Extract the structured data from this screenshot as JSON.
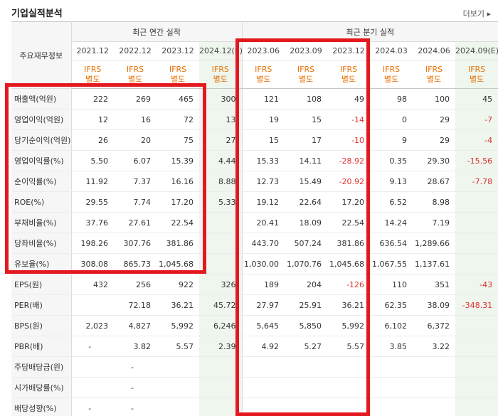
{
  "header": {
    "title": "기업실적분석",
    "more_label": "더보기 ▸"
  },
  "table": {
    "stub_label": "주요재무정보",
    "annual_group_label": "최근 연간 실적",
    "quarter_group_label": "최근 분기 실적",
    "periods": [
      "2021.12",
      "2022.12",
      "2023.12",
      "2024.12(E)",
      "2023.06",
      "2023.09",
      "2023.12",
      "2024.03",
      "2024.06",
      "2024.09(E)"
    ],
    "standard_label_line1": "IFRS",
    "standard_label_line2": "별도",
    "rows": [
      {
        "label": "매출액(억원)",
        "values": [
          "222",
          "269",
          "465",
          "300",
          "121",
          "108",
          "49",
          "98",
          "100",
          "45"
        ]
      },
      {
        "label": "영업이익(억원)",
        "values": [
          "12",
          "16",
          "72",
          "13",
          "19",
          "15",
          "-14",
          "0",
          "29",
          "-7"
        ]
      },
      {
        "label": "당기순이익(억원)",
        "values": [
          "26",
          "20",
          "75",
          "27",
          "15",
          "17",
          "-10",
          "9",
          "29",
          "-4"
        ]
      },
      {
        "label": "영업이익률(%)",
        "values": [
          "5.50",
          "6.07",
          "15.39",
          "4.44",
          "15.33",
          "14.11",
          "-28.92",
          "0.35",
          "29.30",
          "-15.56"
        ]
      },
      {
        "label": "순이익률(%)",
        "values": [
          "11.92",
          "7.37",
          "16.16",
          "8.88",
          "12.73",
          "15.49",
          "-20.92",
          "9.13",
          "28.67",
          "-7.78"
        ]
      },
      {
        "label": "ROE(%)",
        "values": [
          "29.55",
          "7.74",
          "17.20",
          "5.33",
          "19.12",
          "22.64",
          "17.20",
          "6.52",
          "8.98",
          ""
        ]
      },
      {
        "label": "부채비율(%)",
        "values": [
          "37.76",
          "27.61",
          "22.54",
          "",
          "20.41",
          "18.09",
          "22.54",
          "14.24",
          "7.19",
          ""
        ]
      },
      {
        "label": "당좌비율(%)",
        "values": [
          "198.26",
          "307.76",
          "381.86",
          "",
          "443.70",
          "507.24",
          "381.86",
          "636.54",
          "1,289.66",
          ""
        ]
      },
      {
        "label": "유보율(%)",
        "values": [
          "308.08",
          "865.73",
          "1,045.68",
          "",
          "1,030.00",
          "1,070.76",
          "1,045.68",
          "1,067.55",
          "1,137.61",
          ""
        ]
      },
      {
        "label": "EPS(원)",
        "values": [
          "432",
          "256",
          "922",
          "326",
          "189",
          "204",
          "-126",
          "110",
          "351",
          "-43"
        ]
      },
      {
        "label": "PER(배)",
        "values": [
          "",
          "72.18",
          "36.21",
          "45.72",
          "27.97",
          "25.91",
          "36.21",
          "62.35",
          "38.09",
          "-348.31"
        ]
      },
      {
        "label": "BPS(원)",
        "values": [
          "2,023",
          "4,827",
          "5,992",
          "6,246",
          "5,645",
          "5,850",
          "5,992",
          "6,102",
          "6,372",
          ""
        ]
      },
      {
        "label": "PBR(배)",
        "values": [
          "-",
          "3.82",
          "5.57",
          "2.39",
          "4.92",
          "5.27",
          "5.57",
          "3.85",
          "3.22",
          ""
        ]
      },
      {
        "label": "주당배당금(원)",
        "values": [
          "",
          "-",
          "",
          "",
          "",
          "",
          "",
          "",
          "",
          ""
        ]
      },
      {
        "label": "시가배당률(%)",
        "values": [
          "",
          "-",
          "",
          "",
          "",
          "",
          "",
          "",
          "",
          ""
        ]
      },
      {
        "label": "배당성향(%)",
        "values": [
          "-",
          "-",
          "",
          "",
          "",
          "",
          "",
          "",
          "",
          ""
        ]
      }
    ]
  },
  "highlight_color": "#e3191f",
  "negative_color": "#e03030",
  "standard_color": "#e8740a",
  "estimate_bg": "#eef6ee"
}
